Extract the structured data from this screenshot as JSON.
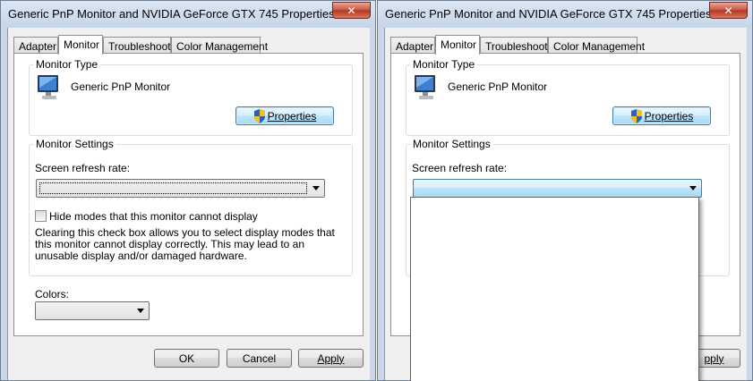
{
  "windows": [
    {
      "title": "Generic PnP Monitor and NVIDIA GeForce GTX 745 Properties",
      "tabs": [
        {
          "label": "Adapter"
        },
        {
          "label": "Monitor"
        },
        {
          "label": "Troubleshoot"
        },
        {
          "label": "Color Management"
        }
      ],
      "monitor_type": {
        "group_label": "Monitor Type",
        "monitor_name": "Generic PnP Monitor",
        "properties_button": "Properties"
      },
      "monitor_settings": {
        "group_label": "Monitor Settings",
        "refresh_label": "Screen refresh rate:",
        "refresh_value": "",
        "hide_modes_label": "Hide modes that this monitor cannot display",
        "hide_modes_checked": false,
        "description": "Clearing this check box allows you to select display modes that this monitor cannot display correctly. This may lead to an unusable display and/or damaged hardware."
      },
      "colors": {
        "label": "Colors:",
        "value": ""
      },
      "buttons": {
        "ok": "OK",
        "cancel": "Cancel",
        "apply": "Apply"
      }
    },
    {
      "title": "Generic PnP Monitor and NVIDIA GeForce GTX 745 Properties",
      "tabs": [
        {
          "label": "Adapter"
        },
        {
          "label": "Monitor"
        },
        {
          "label": "Troubleshoot"
        },
        {
          "label": "Color Management"
        }
      ],
      "monitor_type": {
        "group_label": "Monitor Type",
        "monitor_name": "Generic PnP Monitor",
        "properties_button": "Properties"
      },
      "monitor_settings": {
        "group_label": "Monitor Settings",
        "refresh_label": "Screen refresh rate:",
        "refresh_value": "",
        "dropdown_open": true
      },
      "buttons": {
        "apply_partial": "pply"
      }
    }
  ],
  "icons": {
    "close": "close-icon",
    "monitor": "monitor-icon",
    "uac_shield": "shield-icon",
    "dropdown": "chevron-down-icon"
  },
  "colors": {
    "title_bar": "#c9d7e8",
    "close_button": "#c7513d",
    "focused_button": "#bee6fd",
    "dialog_bg": "#f0f0f0"
  }
}
